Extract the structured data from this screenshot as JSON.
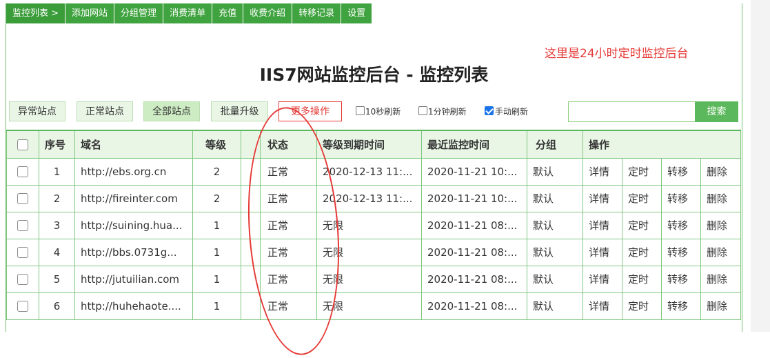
{
  "nav": {
    "items": [
      "监控列表 >",
      "添加网站",
      "分组管理",
      "消费清单",
      "充值",
      "收费介绍",
      "转移记录",
      "设置"
    ]
  },
  "note": "这里是24小时定时监控后台",
  "title": "IIS7网站监控后台 - 监控列表",
  "toolbar": {
    "abnormal": "异常站点",
    "normal": "正常站点",
    "all": "全部站点",
    "batch_upgrade": "批量升级",
    "more_actions": "更多操作",
    "refresh_10s": "10秒刷新",
    "refresh_1m": "1分钟刷新",
    "refresh_manual": "手动刷新",
    "search_placeholder": "",
    "search_button": "搜索"
  },
  "table": {
    "headers": [
      "序号",
      "域名",
      "等级",
      "状态",
      "等级到期时间",
      "最近监控时间",
      "分组",
      "操作"
    ],
    "actions": [
      "详情",
      "定时",
      "转移",
      "删除"
    ],
    "rows": [
      {
        "no": "1",
        "domain": "http://ebs.org.cn",
        "level": "2",
        "status": "正常",
        "expire": "2020-12-13 11:...",
        "last": "2020-11-21 10:...",
        "group": "默认"
      },
      {
        "no": "2",
        "domain": "http://fireinter.com",
        "level": "2",
        "status": "正常",
        "expire": "2020-12-13 11:...",
        "last": "2020-11-21 10:...",
        "group": "默认"
      },
      {
        "no": "3",
        "domain": "http://suining.hua...",
        "level": "1",
        "status": "正常",
        "expire": "无限",
        "last": "2020-11-21 08:...",
        "group": "默认"
      },
      {
        "no": "4",
        "domain": "http://bbs.0731g...",
        "level": "1",
        "status": "正常",
        "expire": "无限",
        "last": "2020-11-21 08:...",
        "group": "默认"
      },
      {
        "no": "5",
        "domain": "http://jutuilian.com",
        "level": "1",
        "status": "正常",
        "expire": "无限",
        "last": "2020-11-21 08:...",
        "group": "默认"
      },
      {
        "no": "6",
        "domain": "http://huhehaote....",
        "level": "1",
        "status": "正常",
        "expire": "无限",
        "last": "2020-11-21 08:...",
        "group": "默认"
      }
    ]
  },
  "colors": {
    "accent": "#3fa33f",
    "danger": "#e53935",
    "header_bg": "#e9f6e6"
  }
}
